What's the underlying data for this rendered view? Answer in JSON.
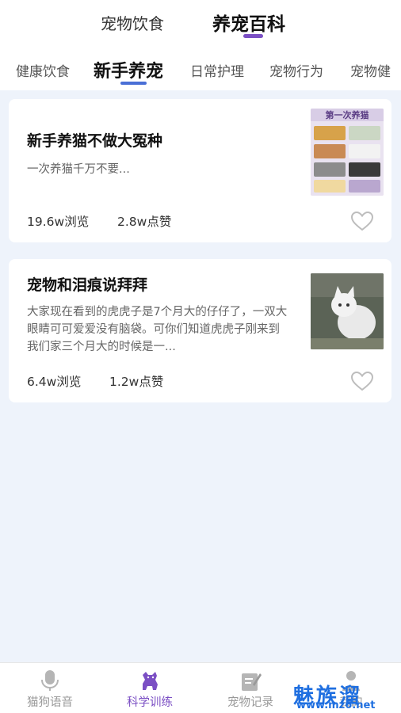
{
  "top_tabs": [
    {
      "label": "宠物饮食",
      "active": false
    },
    {
      "label": "养宠百科",
      "active": true
    }
  ],
  "sub_tabs": [
    {
      "label": "健康饮食",
      "active": false
    },
    {
      "label": "新手养宠",
      "active": true
    },
    {
      "label": "日常护理",
      "active": false
    },
    {
      "label": "宠物行为",
      "active": false
    },
    {
      "label": "宠物健",
      "active": false
    }
  ],
  "articles": [
    {
      "title": "新手养猫不做大冤种",
      "desc": "一次养猫千万不要...",
      "views": "19.6w浏览",
      "likes": "2.8w点赞",
      "thumb_text": "第一次养猫",
      "liked": false
    },
    {
      "title": "宠物和泪痕说拜拜",
      "desc": "大家现在看到的虎虎子是7个月大的仔仔了，一双大眼睛可可爱爱没有脑袋。可你们知道虎虎子刚来到我们家三个月大的时候是一...",
      "views": "6.4w浏览",
      "likes": "1.2w点赞",
      "thumb_text": "",
      "liked": false
    }
  ],
  "bottom_nav": [
    {
      "label": "猫狗语音",
      "icon": "microphone-icon",
      "active": false
    },
    {
      "label": "科学训练",
      "icon": "dog-icon",
      "active": true
    },
    {
      "label": "宠物记录",
      "icon": "edit-note-icon",
      "active": false
    },
    {
      "label": "我的",
      "icon": "user-icon",
      "active": false
    }
  ],
  "watermark": {
    "text": "魅族溜",
    "url": "www.mz6.net"
  },
  "colors": {
    "accent": "#7b4fc4",
    "sub_indicator": "#4a6fd6",
    "background": "#eef3fb"
  }
}
